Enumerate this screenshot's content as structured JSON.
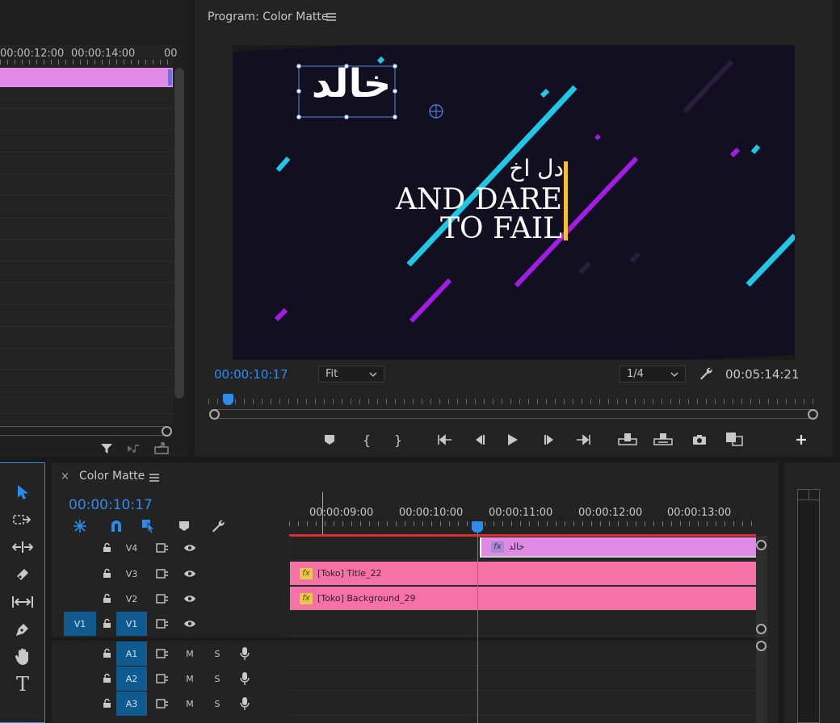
{
  "source_panel": {
    "ruler_ticks": [
      "00:00:12:00",
      "00:00:14:00",
      "00"
    ]
  },
  "program_monitor": {
    "title": "Program: Color Matte",
    "menu_icon": "hamburger-icon",
    "timecode": "00:00:10:17",
    "zoom": "Fit",
    "resolution": "1/4",
    "duration": "00:05:14:21",
    "video": {
      "title_text": "خالد",
      "arabic_line": "دل اخ",
      "line2": "AND DARE",
      "line3": "TO FAIL",
      "colors": {
        "background": "#121020",
        "cyan": "#1ec8e6",
        "purple": "#a21ce6",
        "accent_bar": "#f2c230"
      }
    },
    "transport_icons": [
      "add-marker-icon",
      "mark-in-icon",
      "mark-out-icon",
      "go-to-in-icon",
      "step-back-icon",
      "play-icon",
      "step-forward-icon",
      "go-to-out-icon",
      "lift-icon",
      "extract-icon",
      "export-frame-icon",
      "compare-icon",
      "plus-icon"
    ]
  },
  "tools": [
    "selection-tool-icon",
    "track-select-icon",
    "ripple-edit-icon",
    "razor-icon",
    "slip-icon",
    "pen-icon",
    "hand-icon",
    "type-icon"
  ],
  "timeline": {
    "close": "×",
    "tab_title": "Color Matte",
    "timecode": "00:00:10:17",
    "ruler": [
      "00:00:09:00",
      "00:00:10:00",
      "00:00:11:00",
      "00:00:12:00",
      "00:00:13:00"
    ],
    "video_tracks": [
      {
        "name": "V4",
        "source": ""
      },
      {
        "name": "V3",
        "source": ""
      },
      {
        "name": "V2",
        "source": ""
      },
      {
        "name": "V1",
        "source": "V1"
      }
    ],
    "audio_tracks": [
      {
        "name": "A1",
        "m": "M",
        "s": "S"
      },
      {
        "name": "A2",
        "m": "M",
        "s": "S"
      },
      {
        "name": "A3",
        "m": "M",
        "s": "S"
      }
    ],
    "clips": {
      "v4": {
        "fx": "fx",
        "label": "خالد",
        "color": "#e08ae6"
      },
      "v3": {
        "fx": "fx",
        "label": "[Toko] Title_22",
        "color": "#f472a6"
      },
      "v2": {
        "fx": "fx",
        "label": "[Toko] Background_29",
        "color": "#f472a6"
      }
    }
  }
}
